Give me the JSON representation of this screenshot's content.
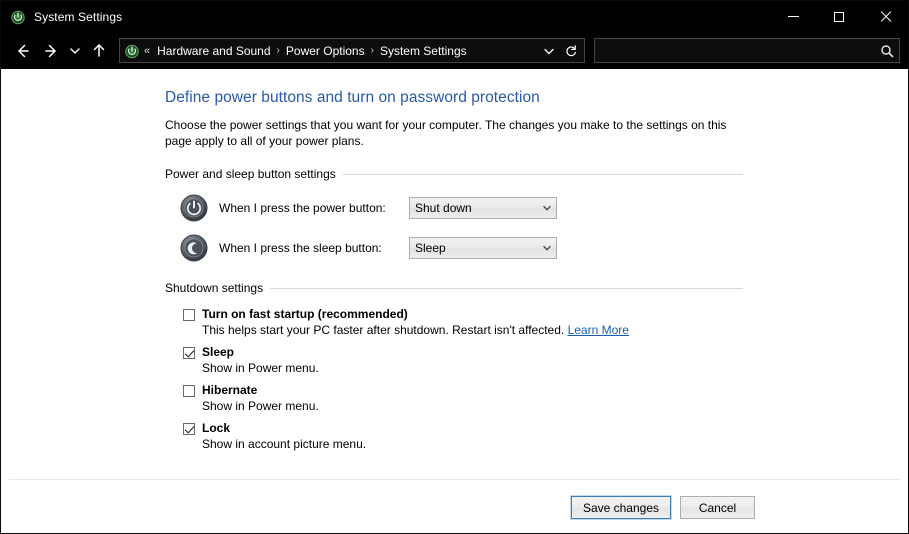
{
  "window": {
    "title": "System Settings",
    "icon": "power-options-icon",
    "controls": {
      "minimize": "Minimize",
      "maximize": "Maximize",
      "close": "Close"
    }
  },
  "nav": {
    "back": "Back",
    "forward": "Forward",
    "recent": "Recent locations",
    "up": "Up one level",
    "address": {
      "icon": "power-options-icon",
      "overflow": "«",
      "crumbs": [
        "Hardware and Sound",
        "Power Options",
        "System Settings"
      ],
      "separator": "›",
      "dropdown": "Previous locations",
      "refresh": "Refresh"
    },
    "search": {
      "value": "",
      "placeholder": "",
      "icon": "search-icon"
    }
  },
  "page": {
    "title": "Define power buttons and turn on password protection",
    "description": "Choose the power settings that you want for your computer. The changes you make to the settings on this page apply to all of your power plans."
  },
  "power_section": {
    "heading": "Power and sleep button settings",
    "rows": [
      {
        "icon": "power-button-icon",
        "label": "When I press the power button:",
        "value": "Shut down"
      },
      {
        "icon": "sleep-button-icon",
        "label": "When I press the sleep button:",
        "value": "Sleep"
      }
    ]
  },
  "shutdown_section": {
    "heading": "Shutdown settings",
    "items": [
      {
        "label": "Turn on fast startup (recommended)",
        "checked": false,
        "description": "This helps start your PC faster after shutdown. Restart isn't affected.",
        "link": "Learn More"
      },
      {
        "label": "Sleep",
        "checked": true,
        "description": "Show in Power menu.",
        "link": ""
      },
      {
        "label": "Hibernate",
        "checked": false,
        "description": "Show in Power menu.",
        "link": ""
      },
      {
        "label": "Lock",
        "checked": true,
        "description": "Show in account picture menu.",
        "link": ""
      }
    ]
  },
  "footer": {
    "save": "Save changes",
    "cancel": "Cancel"
  },
  "colors": {
    "titlebar": "#000000",
    "heading_blue": "#2a59a8",
    "link_blue": "#1a5fb4",
    "focus_border": "#3c7fb1",
    "content_bg": "#ffffff"
  }
}
